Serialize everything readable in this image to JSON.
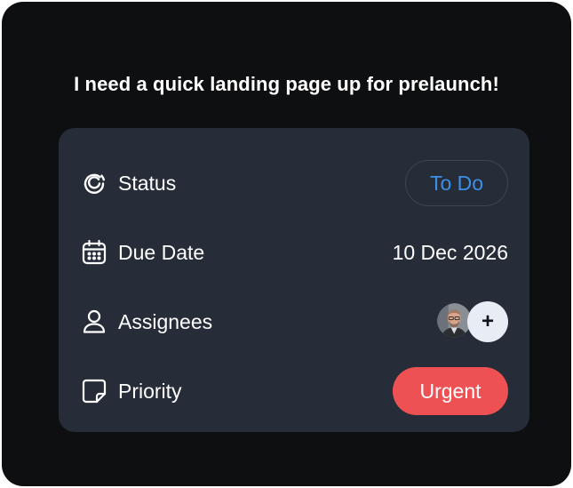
{
  "task": {
    "title": "I need a quick landing page up for prelaunch!"
  },
  "details": {
    "status": {
      "label": "Status",
      "icon": "status-icon",
      "value": "To Do",
      "value_color": "#3d8fe6"
    },
    "due_date": {
      "label": "Due Date",
      "icon": "calendar-icon",
      "value": "10 Dec 2026"
    },
    "assignees": {
      "label": "Assignees",
      "icon": "user-icon",
      "avatar": "avatar-photo",
      "add_symbol": "+"
    },
    "priority": {
      "label": "Priority",
      "icon": "sticky-note-icon",
      "value": "Urgent",
      "value_color": "#ee5153"
    }
  },
  "colors": {
    "outer_background": "#0e0f11",
    "panel_background": "#262d38",
    "accent_blue": "#3d8fe6",
    "urgent_red": "#ee5153"
  }
}
